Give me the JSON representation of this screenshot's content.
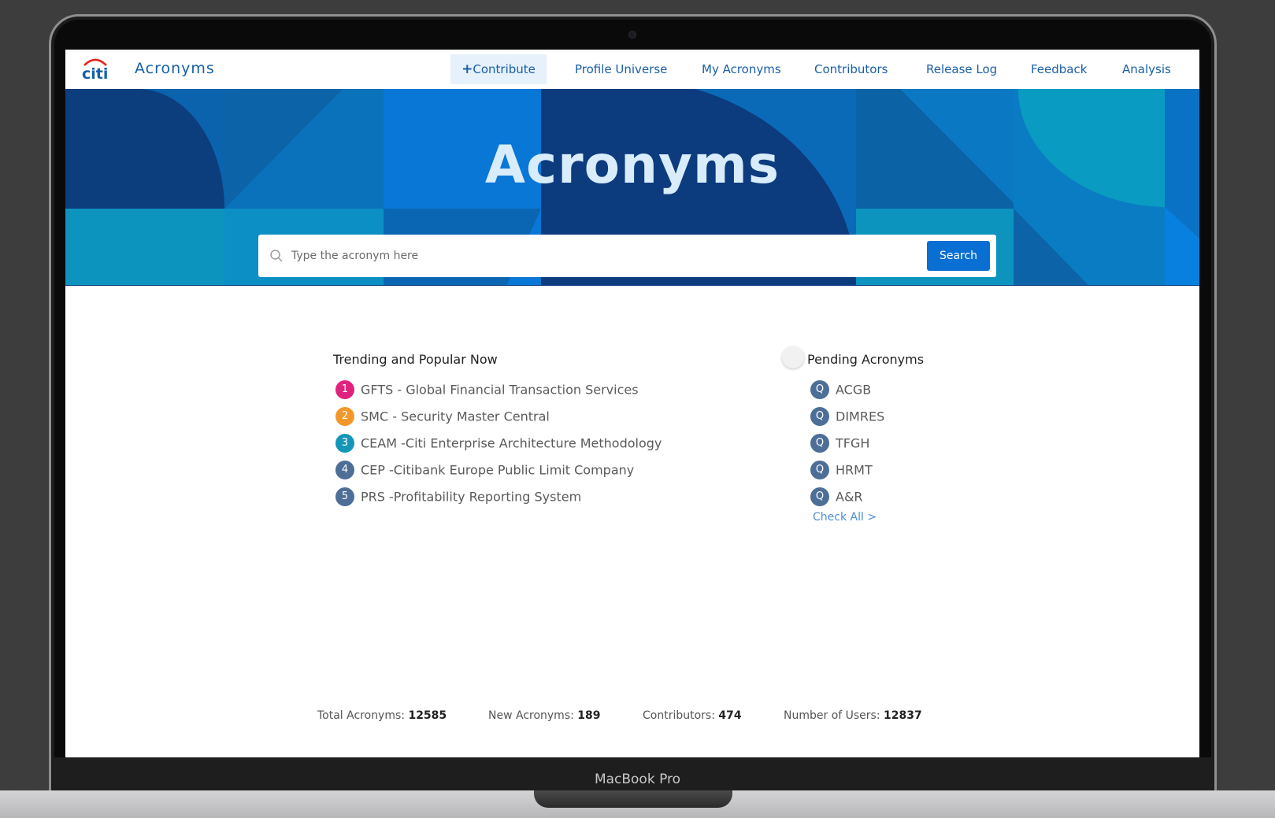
{
  "device": {
    "label": "MacBook Pro"
  },
  "nav": {
    "logo_text": "citi",
    "app_title": "Acronyms",
    "contribute_label": "Contribute",
    "items": [
      {
        "label": "Profile Universe"
      },
      {
        "label": "My Acronyms"
      },
      {
        "label": "Contributors"
      },
      {
        "label": "Release Log"
      },
      {
        "label": "Feedback"
      },
      {
        "label": "Analysis"
      }
    ]
  },
  "hero": {
    "title": "Acronyms",
    "search_placeholder": "Type the acronym here",
    "search_button": "Search"
  },
  "trending": {
    "title": "Trending and Popular Now",
    "items": [
      {
        "rank": "1",
        "text": "GFTS - Global Financial Transaction Services",
        "color": "#e0237f"
      },
      {
        "rank": "2",
        "text": "SMC - Security Master Central",
        "color": "#f2982b"
      },
      {
        "rank": "3",
        "text": "CEAM -Citi Enterprise Architecture Methodology",
        "color": "#1596b9"
      },
      {
        "rank": "4",
        "text": "CEP -Citibank Europe Public Limit Company",
        "color": "#4d6e96"
      },
      {
        "rank": "5",
        "text": "PRS -Profitability Reporting System",
        "color": "#4d6e96"
      }
    ]
  },
  "pending": {
    "title": "Pending Acronyms",
    "badge": "Q",
    "badge_color": "#4d6e96",
    "items": [
      {
        "text": "ACGB"
      },
      {
        "text": "DIMRES"
      },
      {
        "text": "TFGH"
      },
      {
        "text": "HRMT"
      },
      {
        "text": "A&R"
      }
    ],
    "check_all": "Check All >"
  },
  "stats": {
    "total_label": "Total Acronyms:",
    "total_value": "12585",
    "new_label": "New Acronyms:",
    "new_value": "189",
    "contributors_label": "Contributors:",
    "contributors_value": "474",
    "users_label": "Number of Users:",
    "users_value": "12837"
  },
  "colors": {
    "brand_blue": "#1560a8",
    "button_blue": "#0a6fd3",
    "logo_red": "#e2231a"
  }
}
